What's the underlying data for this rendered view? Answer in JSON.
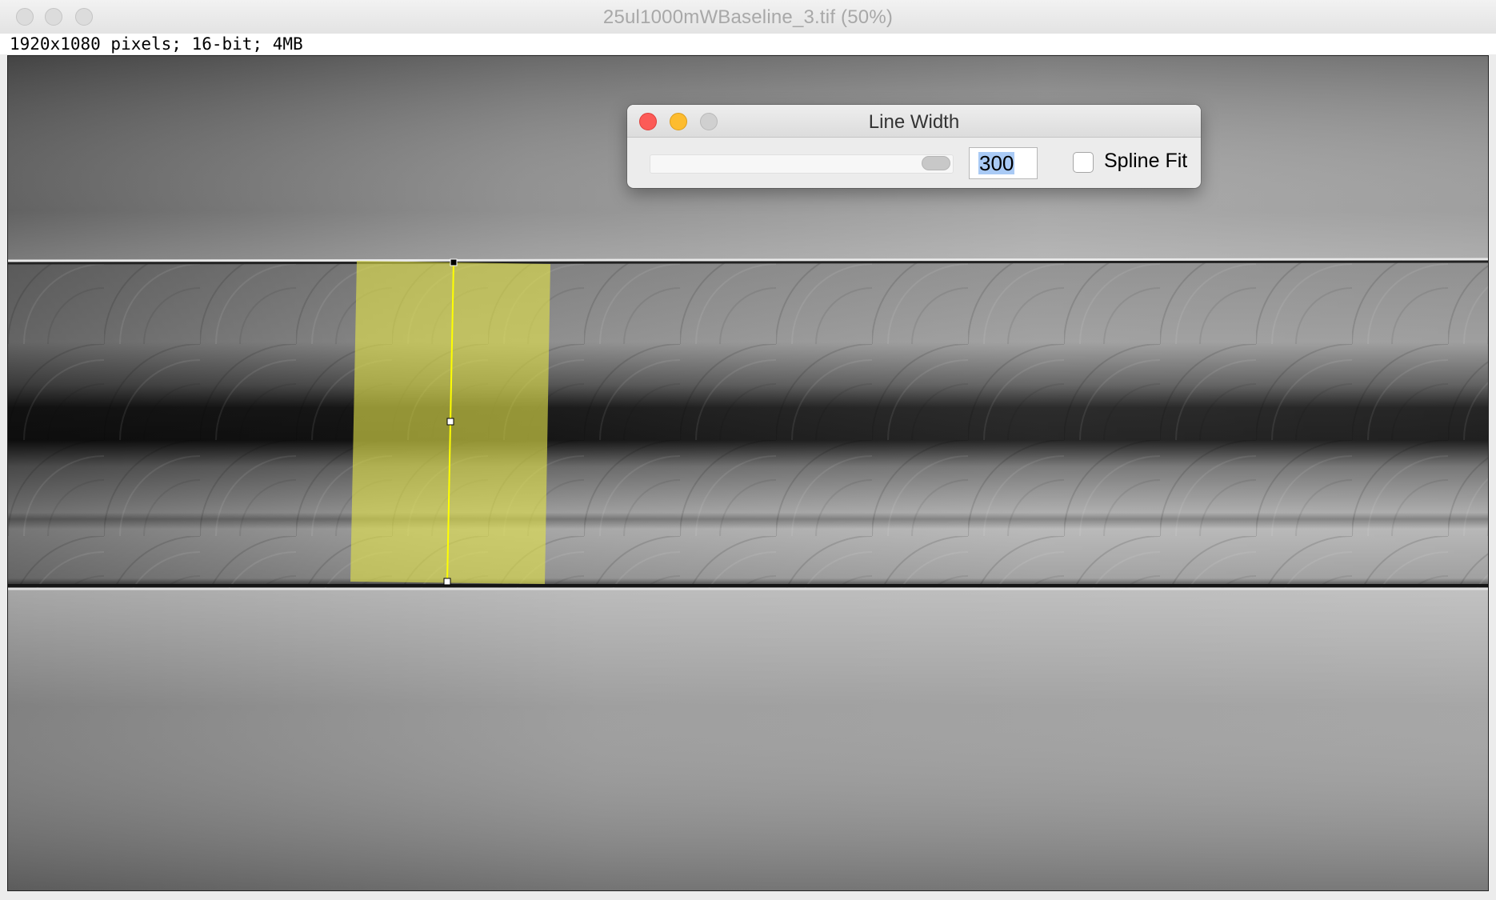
{
  "window": {
    "title": "25ul1000mWBaseline_3.tif (50%)",
    "info": "1920x1080 pixels; 16-bit; 4MB"
  },
  "dialog": {
    "title": "Line Width",
    "width_value": "300",
    "spline_label": "Spline Fit",
    "spline_checked": false
  },
  "selection": {
    "color": "#ffff00",
    "overlay_color": "#e2e24a"
  }
}
